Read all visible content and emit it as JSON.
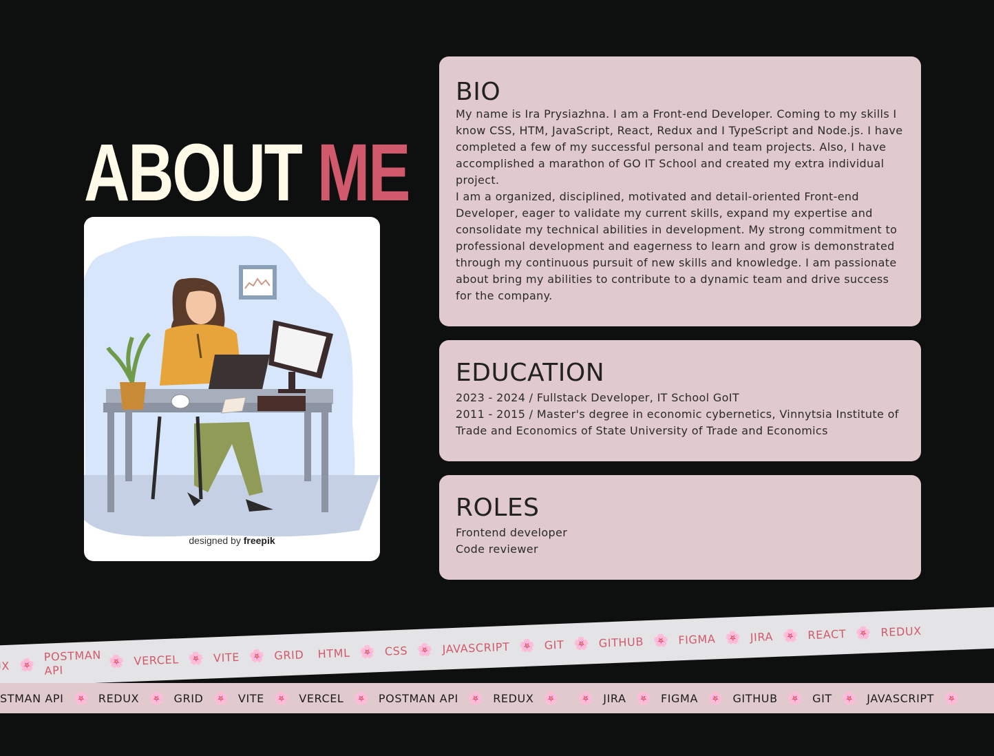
{
  "hero": {
    "word1": "ABOUT",
    "word2": "ME"
  },
  "illustration": {
    "credit_prefix": "designed by",
    "credit_brand": "freepik"
  },
  "bio": {
    "title": "BIO",
    "paragraphs": [
      "My name is Ira Prysiazhna. I am a Front-end Developer. Coming to my skills I know CSS, HTM, JavaScript, React, Redux and I TypeScript and Node.js. I have completed a few of my successful personal and team projects. Also, I have accomplished a marathon of GO IT School and created my extra individual project.",
      "I am a organized, disciplined, motivated and detail-oriented Front-end Developer, eager to validate my current skills, expand my expertise and consolidate my technical abilities in development. My strong commitment to professional development and eagerness to learn and grow is demonstrated through my continuous pursuit of new skills and knowledge. I am passionate about bring my abilities to contribute to a dynamic team and drive success for the company."
    ]
  },
  "education": {
    "title": "EDUCATION",
    "items": [
      "2023 - 2024 / Fullstack Developer, IT School GoIT",
      "2011 - 2015 / Master's degree in economic cybernetics, Vinnytsia Institute of Trade and Economics of State University of Trade and Economics"
    ]
  },
  "roles": {
    "title": "ROLES",
    "items": [
      "Frontend developer",
      "Code reviewer"
    ]
  },
  "marquee_top": {
    "separator": "🌸",
    "items": [
      "UX",
      "POSTMAN API",
      "VERCEL",
      "VITE",
      "GRID",
      "HTML",
      "CSS",
      "JAVASCRIPT",
      "GIT",
      "GITHUB",
      "FIGMA",
      "JIRA",
      "REACT",
      "REDUX"
    ]
  },
  "marquee_bottom": {
    "separator": "🌸",
    "items": [
      "STMAN API",
      "REDUX",
      "GRID",
      "VITE",
      "VERCEL",
      "POSTMAN API",
      "REDUX",
      "",
      "JIRA",
      "FIGMA",
      "GITHUB",
      "GIT",
      "JAVASCRIPT"
    ]
  },
  "colors": {
    "accent": "#d05a6b",
    "card": "#e1cace",
    "background": "#0e0f0f",
    "title": "#fffbe8"
  }
}
